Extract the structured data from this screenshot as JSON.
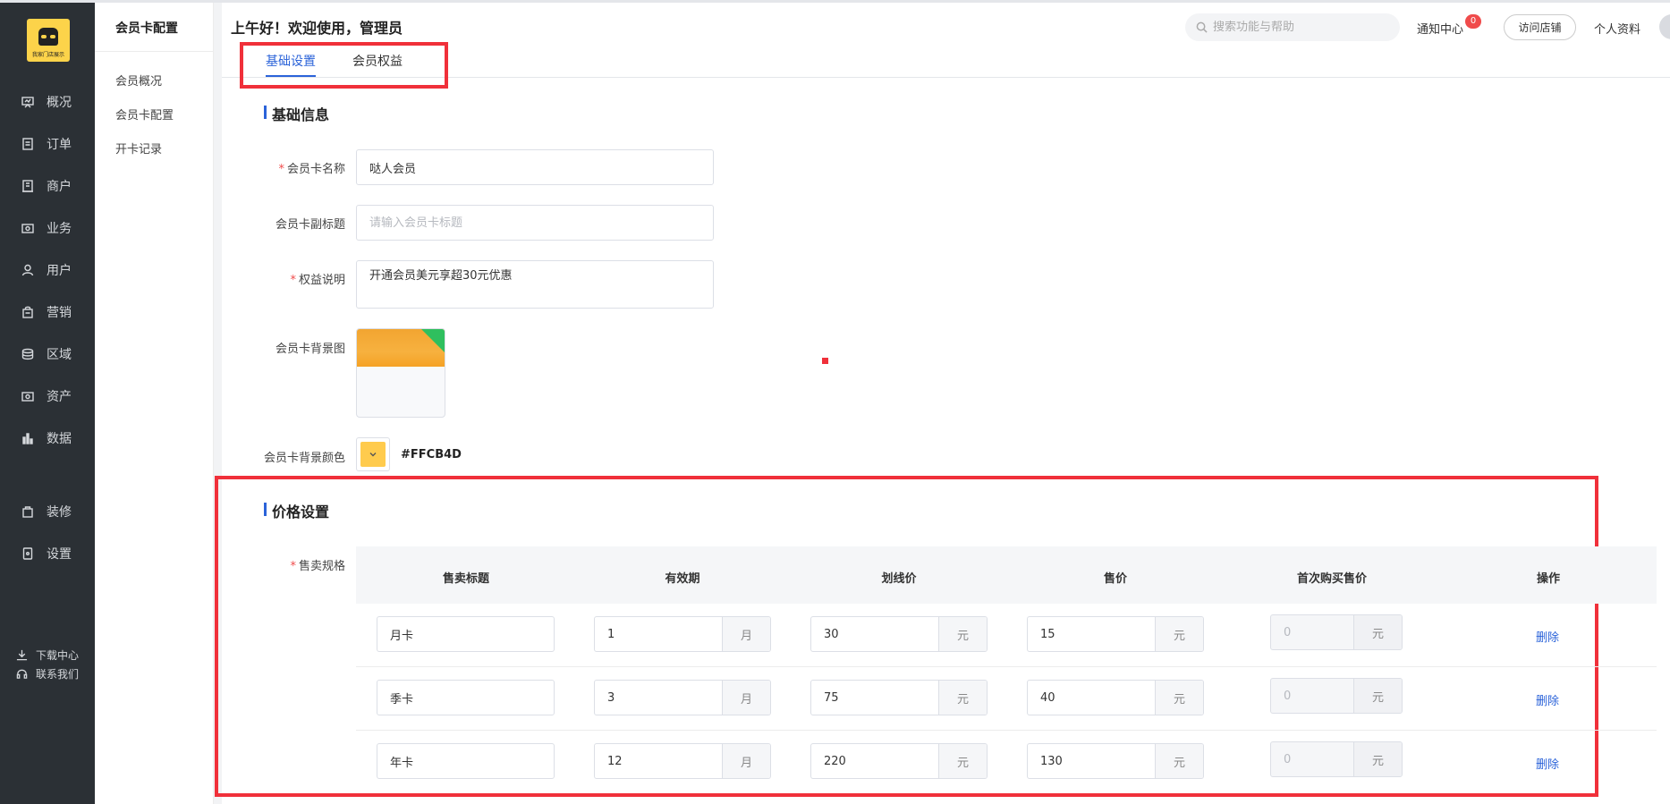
{
  "sidebar": {
    "logo_text": "我家门店展示",
    "items": [
      {
        "label": "概况",
        "icon": "chart-board-icon"
      },
      {
        "label": "订单",
        "icon": "document-icon"
      },
      {
        "label": "商户",
        "icon": "store-icon"
      },
      {
        "label": "业务",
        "icon": "briefcase-icon"
      },
      {
        "label": "用户",
        "icon": "user-icon"
      },
      {
        "label": "营销",
        "icon": "bag-icon"
      },
      {
        "label": "区域",
        "icon": "layers-icon"
      },
      {
        "label": "资产",
        "icon": "wallet-icon"
      },
      {
        "label": "数据",
        "icon": "bar-chart-icon"
      },
      {
        "label": "装修",
        "icon": "paint-bag-icon"
      },
      {
        "label": "设置",
        "icon": "settings-icon"
      }
    ],
    "download": "下载中心",
    "contact": "联系我们"
  },
  "subnav": {
    "title": "会员卡配置",
    "items": [
      "会员概况",
      "会员卡配置",
      "开卡记录"
    ]
  },
  "header": {
    "greeting": "上午好！欢迎使用，管理员",
    "search_placeholder": "搜索功能与帮助",
    "notify_label": "通知中心",
    "notify_count": "0",
    "visit_label": "访问店铺",
    "profile_label": "个人资料"
  },
  "tabs": [
    {
      "label": "基础设置",
      "active": true
    },
    {
      "label": "会员权益",
      "active": false
    }
  ],
  "basic": {
    "title": "基础信息",
    "name_label": "会员卡名称",
    "name_value": "哒人会员",
    "subtitle_label": "会员卡副标题",
    "subtitle_placeholder": "请输入会员卡标题",
    "benefit_label": "权益说明",
    "benefit_value": "开通会员美元享超30元优惠",
    "bg_image_label": "会员卡背景图",
    "bg_color_label": "会员卡背景颜色",
    "bg_color_value": "#FFCB4D"
  },
  "price": {
    "title": "价格设置",
    "spec_label": "售卖规格",
    "columns": [
      "售卖标题",
      "有效期",
      "划线价",
      "售价",
      "首次购买售价",
      "操作"
    ],
    "month_unit": "月",
    "yuan_unit": "元",
    "delete_label": "删除",
    "rows": [
      {
        "title": "月卡",
        "period": "1",
        "strike": "30",
        "price": "15",
        "first": "0"
      },
      {
        "title": "季卡",
        "period": "3",
        "strike": "75",
        "price": "40",
        "first": "0"
      },
      {
        "title": "年卡",
        "period": "12",
        "strike": "220",
        "price": "130",
        "first": "0"
      }
    ]
  },
  "colors": {
    "sidebar_bg": "#2b3035",
    "accent": "#2b63d9",
    "highlight": "#f0303a",
    "card_color": "#ffcb4d"
  }
}
